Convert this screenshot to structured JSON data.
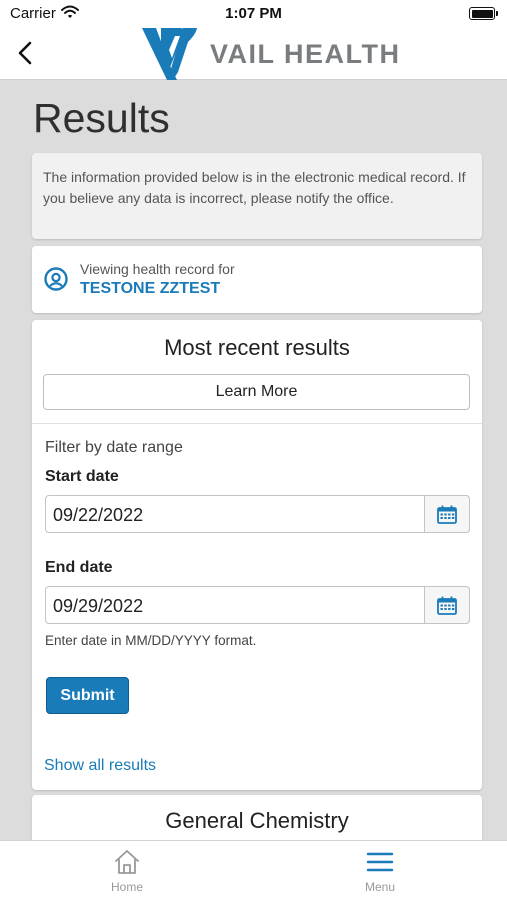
{
  "status_bar": {
    "carrier": "Carrier",
    "time": "1:07 PM"
  },
  "header": {
    "brand": "VAIL HEALTH",
    "brand_color": "#1a7bb9"
  },
  "page": {
    "title": "Results"
  },
  "notice": {
    "text": "The information provided below is in the electronic medical record. If you believe any data is incorrect, please notify the office."
  },
  "patient": {
    "viewing_label": "Viewing health record for",
    "name": "TESTONE ZZTEST"
  },
  "recent_results": {
    "title": "Most recent results",
    "learn_more_label": "Learn More",
    "filter_label": "Filter by date range",
    "start_label": "Start date",
    "start_value": "09/22/2022",
    "end_label": "End date",
    "end_value": "09/29/2022",
    "date_hint": "Enter date in MM/DD/YYYY format.",
    "submit_label": "Submit",
    "show_all_label": "Show all results"
  },
  "next_section": {
    "title": "General Chemistry"
  },
  "tab_bar": {
    "home_label": "Home",
    "menu_label": "Menu"
  }
}
